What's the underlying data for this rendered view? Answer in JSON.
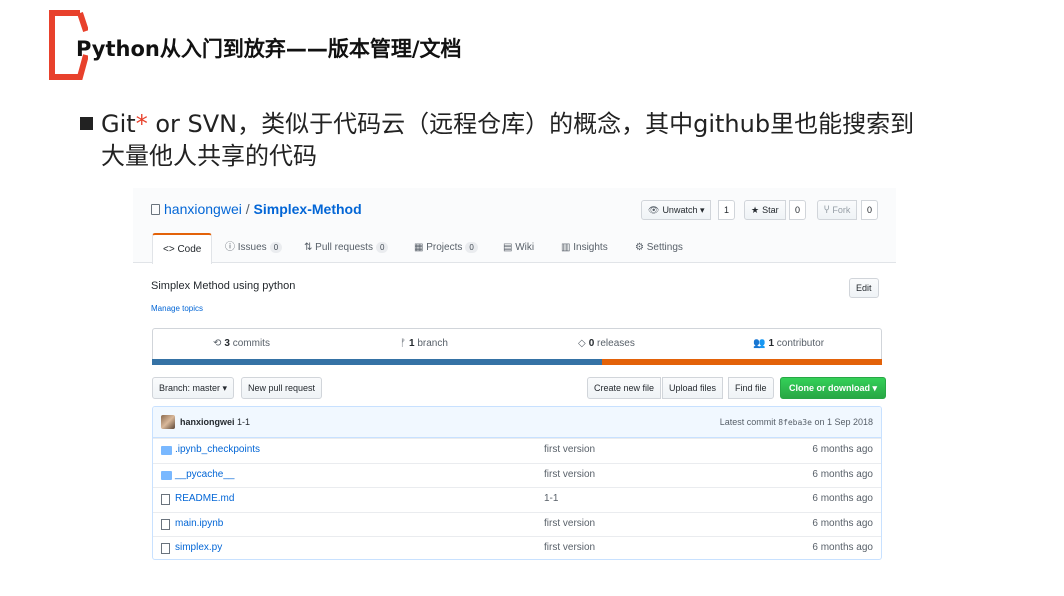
{
  "slide": {
    "title": "Python从入门到放弃——版本管理/文档",
    "bullet": {
      "before_star": "Git",
      "star": "*",
      "after_star": " or SVN，类似于代码云（远程仓库）的概念，其中github里也能搜索到",
      "line2": "大量他人共享的代码"
    },
    "accent_color": "#e8412c"
  },
  "github": {
    "owner": "hanxiongwei",
    "separator": "/",
    "repo": "Simplex-Method",
    "actions": {
      "watch_label": "Unwatch ▾",
      "watch_count": "1",
      "star_label": "Star",
      "star_count": "0",
      "fork_label": "Fork",
      "fork_count": "0"
    },
    "tabs": [
      {
        "label": "<> Code",
        "count": ""
      },
      {
        "label": "ⓘ Issues",
        "count": "0"
      },
      {
        "label": "⇅ Pull requests",
        "count": "0"
      },
      {
        "label": "▦ Projects",
        "count": "0"
      },
      {
        "label": "▤ Wiki",
        "count": ""
      },
      {
        "label": "▥ Insights",
        "count": ""
      },
      {
        "label": "⚙ Settings",
        "count": ""
      }
    ],
    "description": "Simplex Method using python",
    "manage_topics": "Manage topics",
    "edit_label": "Edit",
    "summary": {
      "commits_num": "3",
      "commits_label": " commits",
      "branch_num": "1",
      "branch_label": " branch",
      "releases_num": "0",
      "releases_label": " releases",
      "contributor_num": "1",
      "contributor_label": " contributor"
    },
    "language_colors": [
      "#3572A5",
      "#e36209"
    ],
    "language_shares": [
      0.616,
      0.384
    ],
    "toolbar": {
      "branch": "Branch: master ▾",
      "new_pr": "New pull request",
      "create_file": "Create new file",
      "upload_files": "Upload files",
      "find_file": "Find file",
      "clone": "Clone or download ▾"
    },
    "commit": {
      "author": "hanxiongwei",
      "message": " 1-1",
      "latest_prefix": "Latest commit ",
      "sha": "8feba3e",
      "date": " on 1 Sep 2018"
    },
    "files": [
      {
        "name": ".ipynb_checkpoints",
        "type": "folder",
        "message": "first version",
        "age": "6 months ago"
      },
      {
        "name": "__pycache__",
        "type": "folder",
        "message": "first version",
        "age": "6 months ago"
      },
      {
        "name": "README.md",
        "type": "file",
        "message": "1-1",
        "age": "6 months ago"
      },
      {
        "name": "main.ipynb",
        "type": "file",
        "message": "first version",
        "age": "6 months ago"
      },
      {
        "name": "simplex.py",
        "type": "file",
        "message": "first version",
        "age": "6 months ago"
      }
    ]
  }
}
